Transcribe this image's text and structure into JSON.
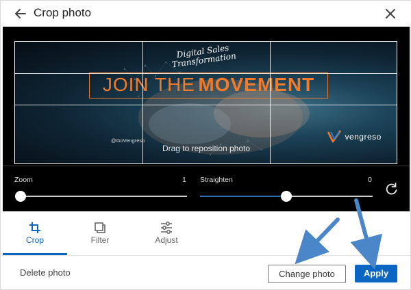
{
  "header": {
    "title": "Crop photo",
    "back_icon": "back-arrow-icon",
    "close_icon": "close-icon"
  },
  "editor": {
    "drag_hint": "Drag to reposition photo",
    "image": {
      "tagline_line1": "Digital Sales",
      "tagline_line2": "Transformation",
      "headline_part1": "JOIN THE",
      "headline_part2": "MOVEMENT",
      "handle": "@GoVengreso",
      "brand": "vengreso"
    },
    "zoom": {
      "label": "Zoom",
      "value": "1",
      "level": 0
    },
    "straighten": {
      "label": "Straighten",
      "value": "0",
      "level": 0.5
    },
    "reset_icon": "rotate-reset-icon"
  },
  "tabs": [
    {
      "label": "Crop",
      "icon": "crop-icon",
      "active": true
    },
    {
      "label": "Filter",
      "icon": "filter-icon",
      "active": false
    },
    {
      "label": "Adjust",
      "icon": "adjust-sliders-icon",
      "active": false
    }
  ],
  "footer": {
    "delete_label": "Delete photo",
    "change_label": "Change photo",
    "apply_label": "Apply"
  },
  "colors": {
    "accent": "#0a66c2",
    "headline_orange": "#f07b2a",
    "annotation_arrow": "#4a86c8"
  }
}
